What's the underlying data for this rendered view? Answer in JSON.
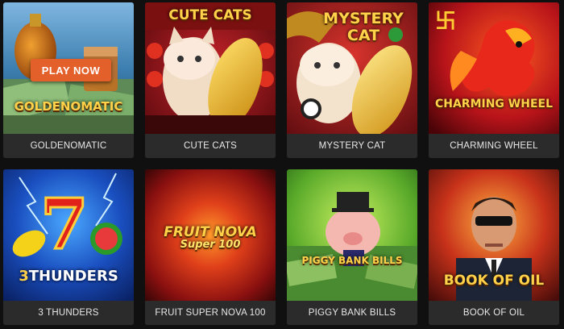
{
  "play_now_label": "PLAY NOW",
  "games": [
    {
      "caption": "GOLDENOMATIC",
      "art_text": "GOLDENOMATIC"
    },
    {
      "caption": "CUTE CATS",
      "art_text": "CUTE CATS"
    },
    {
      "caption": "MYSTERY CAT",
      "art_text": "MYSTERY CAT"
    },
    {
      "caption": "CHARMING WHEEL",
      "art_text": "CHARMING WHEEL"
    },
    {
      "caption": "3 THUNDERS",
      "art_text": "THUNDERS"
    },
    {
      "caption": "FRUIT SUPER NOVA 100",
      "art_text": "FRUIT NOVA",
      "art_subtext": "Super 100"
    },
    {
      "caption": "PIGGY BANK BILLS",
      "art_text": "PIGGY BANK BILLS"
    },
    {
      "caption": "BOOK OF OIL",
      "art_text": "BOOK OF OIL"
    }
  ],
  "colors": {
    "page_bg": "#101010",
    "caption_bg": "#2b2b2b",
    "play_button": "#e4602a"
  }
}
